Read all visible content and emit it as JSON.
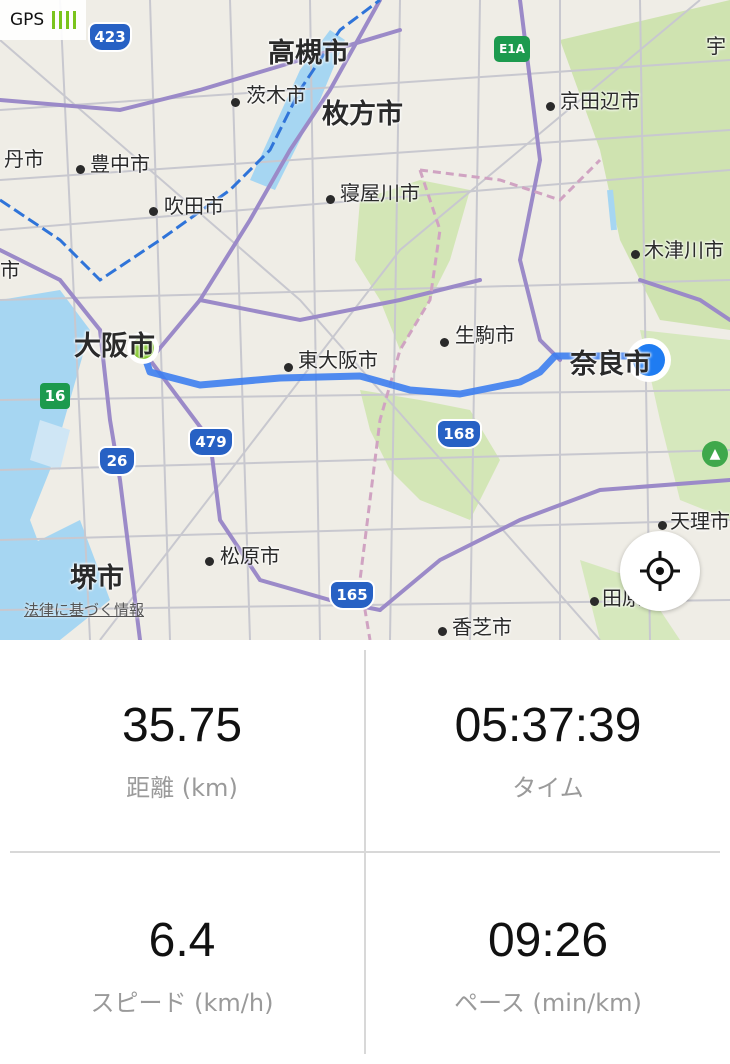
{
  "status": {
    "gps_label": "GPS"
  },
  "map": {
    "cities": [
      {
        "name": "高槻市"
      },
      {
        "name": "枚方市"
      },
      {
        "name": "茨木市"
      },
      {
        "name": "京田辺市"
      },
      {
        "name": "丹市"
      },
      {
        "name": "豊中市"
      },
      {
        "name": "吹田市"
      },
      {
        "name": "寝屋川市"
      },
      {
        "name": "木津川市"
      },
      {
        "name": "市"
      },
      {
        "name": "生駒市"
      },
      {
        "name": "大阪市"
      },
      {
        "name": "東大阪市"
      },
      {
        "name": "奈良市"
      },
      {
        "name": "天理市"
      },
      {
        "name": "松原市"
      },
      {
        "name": "堺市"
      },
      {
        "name": "香芝市"
      },
      {
        "name": "田原"
      },
      {
        "name": "宇"
      }
    ],
    "routes": [
      "423",
      "E1A",
      "16",
      "479",
      "26",
      "168",
      "165"
    ],
    "legal_text": "法律に基づく情報",
    "colors": {
      "route_track": "#3d7ef0",
      "start_marker": "#7ac41c",
      "current_marker": "#1f7cf2",
      "expressway": "#1c9a4e",
      "national_route": "#2761c4"
    }
  },
  "stats": {
    "distance": {
      "value": "35.75",
      "label": "距離 (km)"
    },
    "time": {
      "value": "05:37:39",
      "label": "タイム"
    },
    "speed": {
      "value": "6.4",
      "label": "スピード (km/h)"
    },
    "pace": {
      "value": "09:26",
      "label": "ペース (min/km)"
    }
  }
}
